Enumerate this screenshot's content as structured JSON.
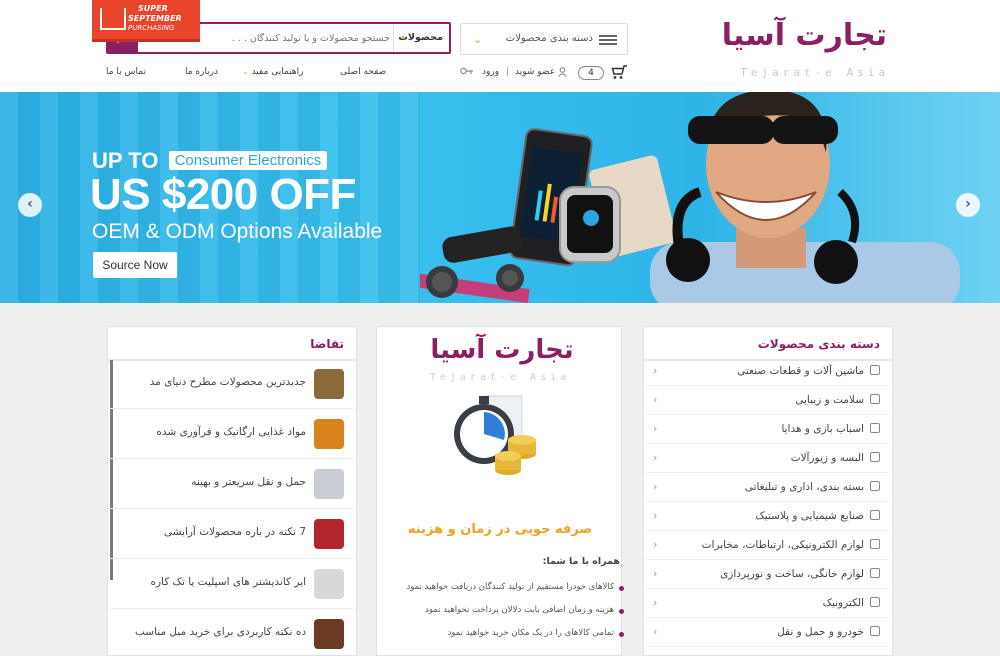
{
  "header": {
    "logo_fa": "تجارت آسیا",
    "logo_en": "Tejarat-e Asia",
    "category_select_label": "دسته بندی محصولات",
    "search": {
      "filter_label": "محصولات",
      "placeholder": "جستجو محصولات و یا تولید کنندگان . . ."
    },
    "links": {
      "contact": "تماس با ما",
      "about": "درباره ما",
      "guide": "راهنمایی مفید",
      "home": "صفحه اصلی",
      "login": "ورود",
      "register": "عضو شوید"
    },
    "cart_count": "4"
  },
  "banner": {
    "badge_line1": "SUPER",
    "badge_line2": "SEPTEMBER",
    "badge_line3": "PURCHASING",
    "upto": "UP TO",
    "pill": "Consumer Electronics",
    "headline": "US $200 OFF",
    "subline": "OEM & ODM Options Available",
    "cta": "Source Now",
    "prev": "‹",
    "next": "›"
  },
  "categories": {
    "title": "دسته بندی محصولات",
    "items": [
      {
        "label": "ماشین آلات و قطعات صنعتی"
      },
      {
        "label": "سلامت و زیبایی"
      },
      {
        "label": "اسباب بازی و هدایا"
      },
      {
        "label": "البسه و زیورآلات"
      },
      {
        "label": "بسته بندی، اداری و تبلیغاتی"
      },
      {
        "label": "صنایع شیمیایی و پلاستیک"
      },
      {
        "label": "لوازم الکترونیکی، ارتباطات، مخابرات"
      },
      {
        "label": "لوازم خانگی، ساخت و نورپردازی"
      },
      {
        "label": "الکترونیک"
      },
      {
        "label": "خودرو و حمل و نقل"
      }
    ]
  },
  "middle": {
    "logo_fa": "تجارت آسیا",
    "logo_en": "Tejarat-e Asia",
    "headline": "صرفه جویی در زمان و هزینه",
    "subtitle": "همراه با ما شما:",
    "bullets": [
      "کالاهای خودرا مستقیم از تولید کنندگان دریافت خواهید نمود",
      "هزینه و زمان اضافی بابت دلالان پرداخت نخواهید نمود",
      "تمامی کالاهای را در یک مکان خرید خواهید نمود"
    ]
  },
  "requests": {
    "title": "تقاضا",
    "items": [
      {
        "label": "جدیدترین محصولات مطرح دنیای مد",
        "thumb_color": "#8a6a3a"
      },
      {
        "label": "مواد غذایی ارگانیک و فرآوری شده",
        "thumb_color": "#d9831f"
      },
      {
        "label": "حمل و نقل سریعتر و بهینه",
        "thumb_color": "#c9ccd2"
      },
      {
        "label": "7 نکته در باره محصولات آرایشی",
        "thumb_color": "#b3262e"
      },
      {
        "label": "ایر کاندیشنر های اسپلیت یا تک کاره",
        "thumb_color": "#d8d8d8"
      },
      {
        "label": "ده نکته کاربردی برای خرید مبل مناسب",
        "thumb_color": "#6b3a24"
      }
    ]
  }
}
